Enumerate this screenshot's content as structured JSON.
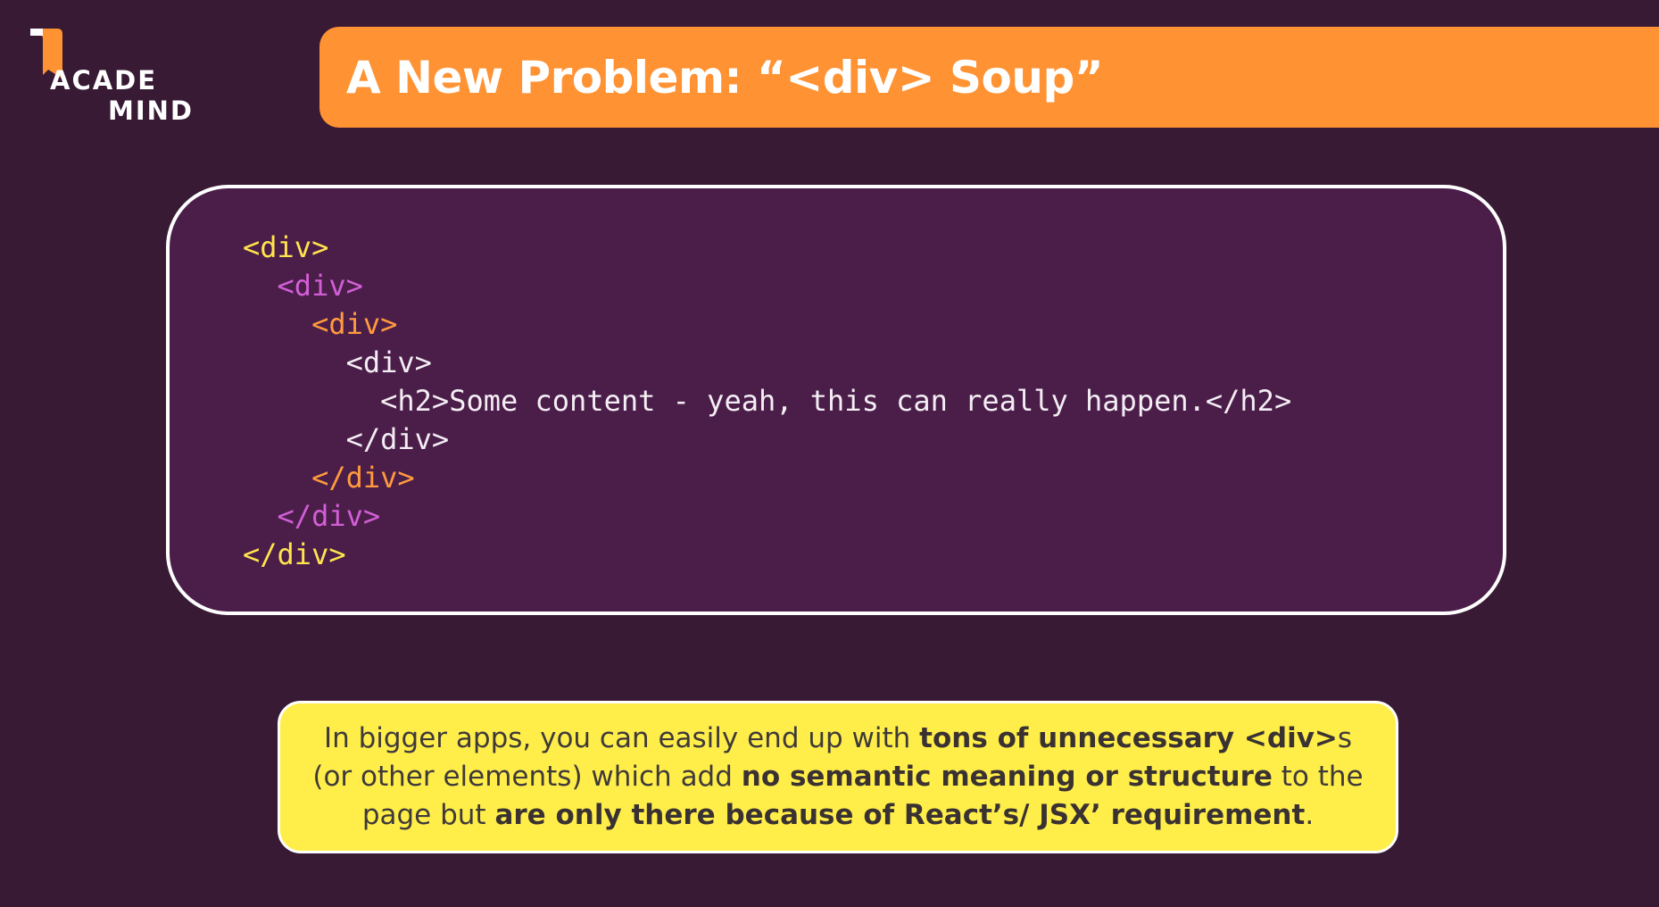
{
  "logo": {
    "line1": "ACADE",
    "line2": "MIND"
  },
  "title": "A New Problem: “<div> Soup”",
  "code": {
    "lines": [
      {
        "text": "<div>",
        "color": "#ffe44d",
        "indent": 0
      },
      {
        "text": "<div>",
        "color": "#d35fd6",
        "indent": 1
      },
      {
        "text": "<div>",
        "color": "#ff9b3d",
        "indent": 2
      },
      {
        "text": "<div>",
        "color": "#f4eef4",
        "indent": 3
      },
      {
        "text": "<h2>Some content - yeah, this can really happen.</h2>",
        "color": "#f4eef4",
        "indent": 4
      },
      {
        "text": "</div>",
        "color": "#f4eef4",
        "indent": 3
      },
      {
        "text": "</div>",
        "color": "#ff9b3d",
        "indent": 2
      },
      {
        "text": "</div>",
        "color": "#d35fd6",
        "indent": 1
      },
      {
        "text": "</div>",
        "color": "#ffe44d",
        "indent": 0
      }
    ]
  },
  "note": {
    "part1": "In bigger apps, you can easily end up with ",
    "bold1": "tons of unnecessary <div>",
    "part2": "s (or other elements) which add ",
    "bold2": "no semantic meaning or structure",
    "part3": " to the page but ",
    "bold3": "are only there because of React’s/ JSX’ requirement",
    "part4": "."
  },
  "colors": {
    "background": "#381a35",
    "title_bar": "#ff9233",
    "code_panel": "#4b1e4a",
    "note_box": "#ffee4a"
  }
}
